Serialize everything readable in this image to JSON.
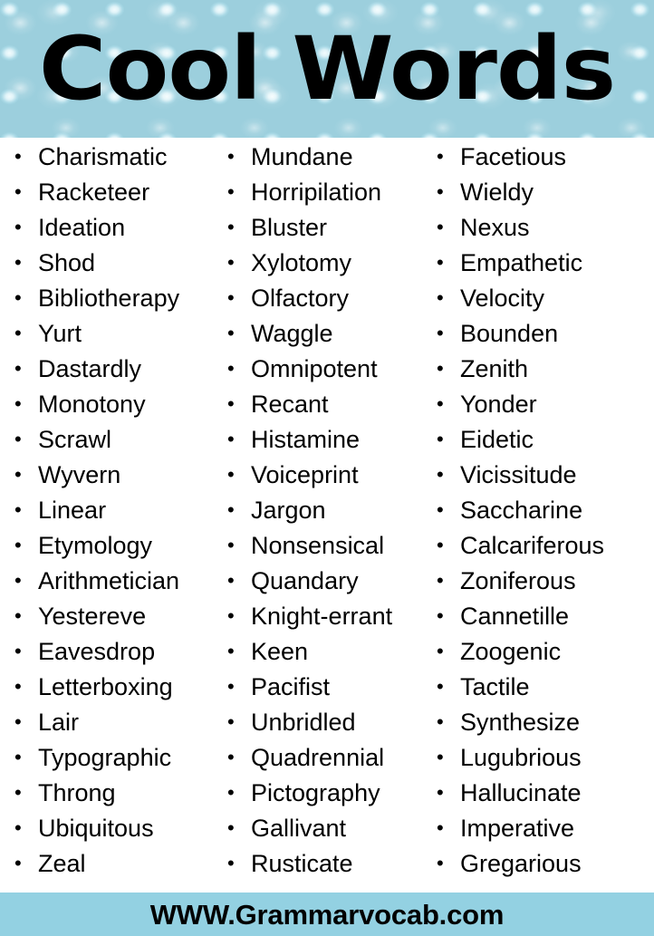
{
  "header": {
    "title": "Cool Words",
    "background_color": "#c3e7f0",
    "texture": "water-droplets",
    "title_color": "#000000"
  },
  "list": {
    "bullet_glyph": "•",
    "text_color": "#000000",
    "columns": [
      {
        "index": 1,
        "words": [
          "Charismatic",
          "Racketeer",
          "Ideation",
          "Shod",
          "Bibliotherapy",
          "Yurt",
          "Dastardly",
          "Monotony",
          "Scrawl",
          "Wyvern",
          "Linear",
          "Etymology",
          "Arithmetician",
          "Yestereve",
          "Eavesdrop",
          "Letterboxing",
          "Lair",
          "Typographic",
          "Throng",
          "Ubiquitous",
          "Zeal"
        ]
      },
      {
        "index": 2,
        "words": [
          "Mundane",
          "Horripilation",
          "Bluster",
          "Xylotomy",
          "Olfactory",
          "Waggle",
          "Omnipotent",
          "Recant",
          "Histamine",
          "Voiceprint",
          "Jargon",
          "Nonsensical",
          "Quandary",
          "Knight-errant",
          "Keen",
          "Pacifist",
          "Unbridled",
          "Quadrennial",
          "Pictography",
          "Gallivant",
          "Rusticate"
        ]
      },
      {
        "index": 3,
        "words": [
          "Facetious",
          "Wieldy",
          "Nexus",
          "Empathetic",
          "Velocity",
          "Bounden",
          "Zenith",
          "Yonder",
          "Eidetic",
          "Vicissitude",
          "Saccharine",
          "Calcariferous",
          "Zoniferous",
          "Cannetille",
          "Zoogenic",
          "Tactile",
          "Synthesize",
          "Lugubrious",
          "Hallucinate",
          "Imperative",
          "Gregarious"
        ]
      }
    ]
  },
  "footer": {
    "text": "WWW.Grammarvocab.com",
    "background_color": "#93d1e2",
    "text_color": "#000000"
  }
}
